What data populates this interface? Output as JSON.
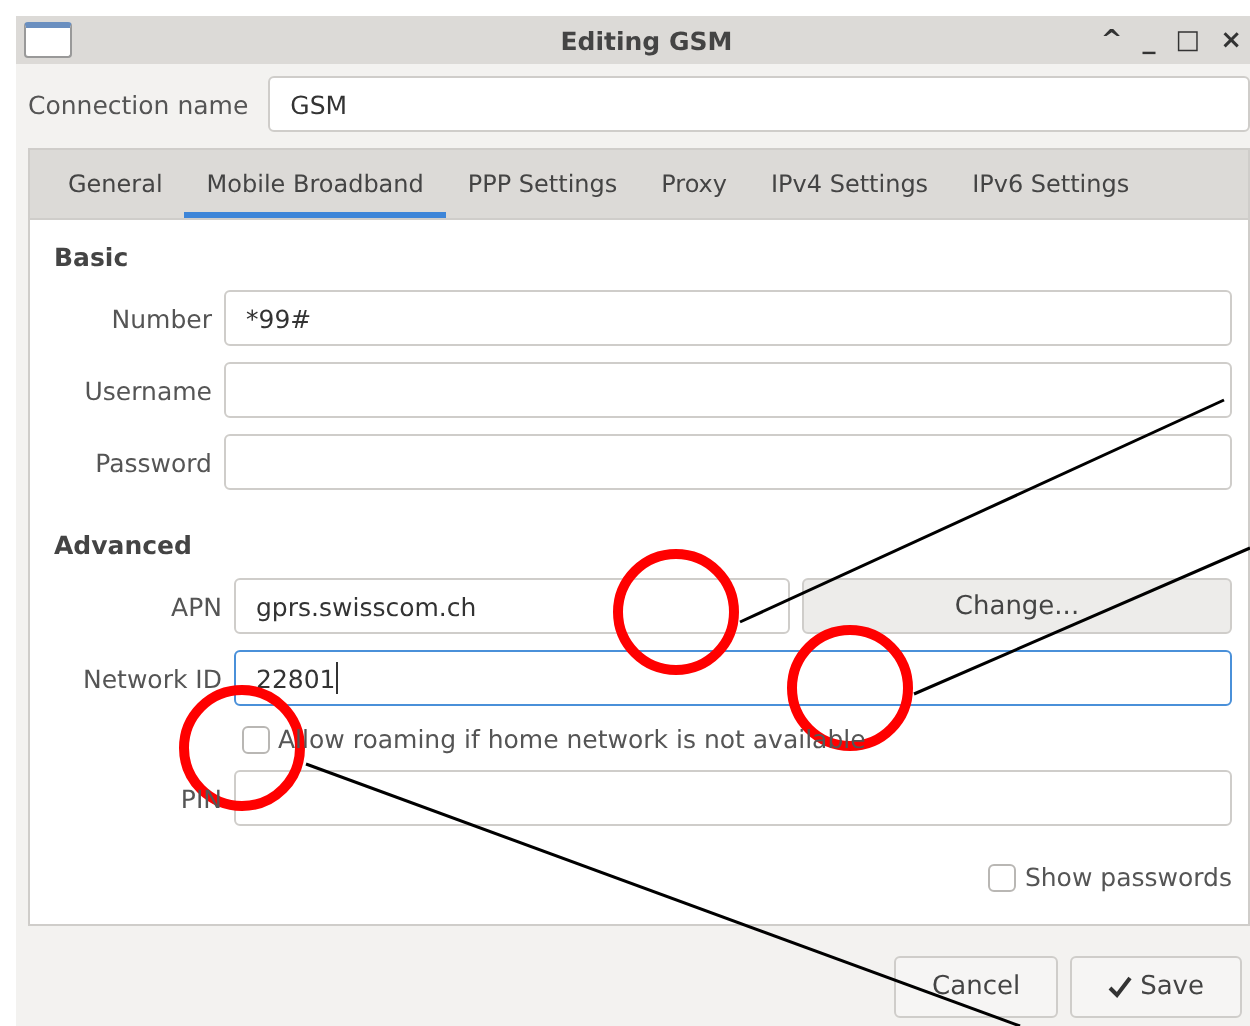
{
  "window": {
    "title": "Editing GSM",
    "controls": [
      "^",
      "_",
      "□",
      "×"
    ]
  },
  "connection_name": {
    "label": "Connection name",
    "value": "GSM"
  },
  "tabs": [
    {
      "label": "General",
      "selected": false
    },
    {
      "label": "Mobile Broadband",
      "selected": true
    },
    {
      "label": "PPP Settings",
      "selected": false
    },
    {
      "label": "Proxy",
      "selected": false
    },
    {
      "label": "IPv4 Settings",
      "selected": false
    },
    {
      "label": "IPv6 Settings",
      "selected": false
    }
  ],
  "basic": {
    "heading": "Basic",
    "fields": [
      {
        "label": "Number",
        "value": "*99#",
        "focused": false
      },
      {
        "label": "Username",
        "focused": false
      },
      {
        "label": "Password",
        "focused": false
      }
    ]
  },
  "advanced": {
    "heading": "Advanced",
    "apn": {
      "label": "APN",
      "value": "gprs.swisscom.ch",
      "button": "Change..."
    },
    "network_id": {
      "label": "Network ID",
      "value": "22801",
      "focused": true
    },
    "roaming": {
      "label": "Allow roaming if home network is not available",
      "checked": false
    },
    "pin": {
      "label": "PIN"
    }
  },
  "show_passwords": {
    "label": "Show passwords",
    "checked": false
  },
  "buttons": [
    {
      "label": "Cancel",
      "kind": "plain"
    },
    {
      "label": "Save",
      "kind": "confirm"
    }
  ]
}
